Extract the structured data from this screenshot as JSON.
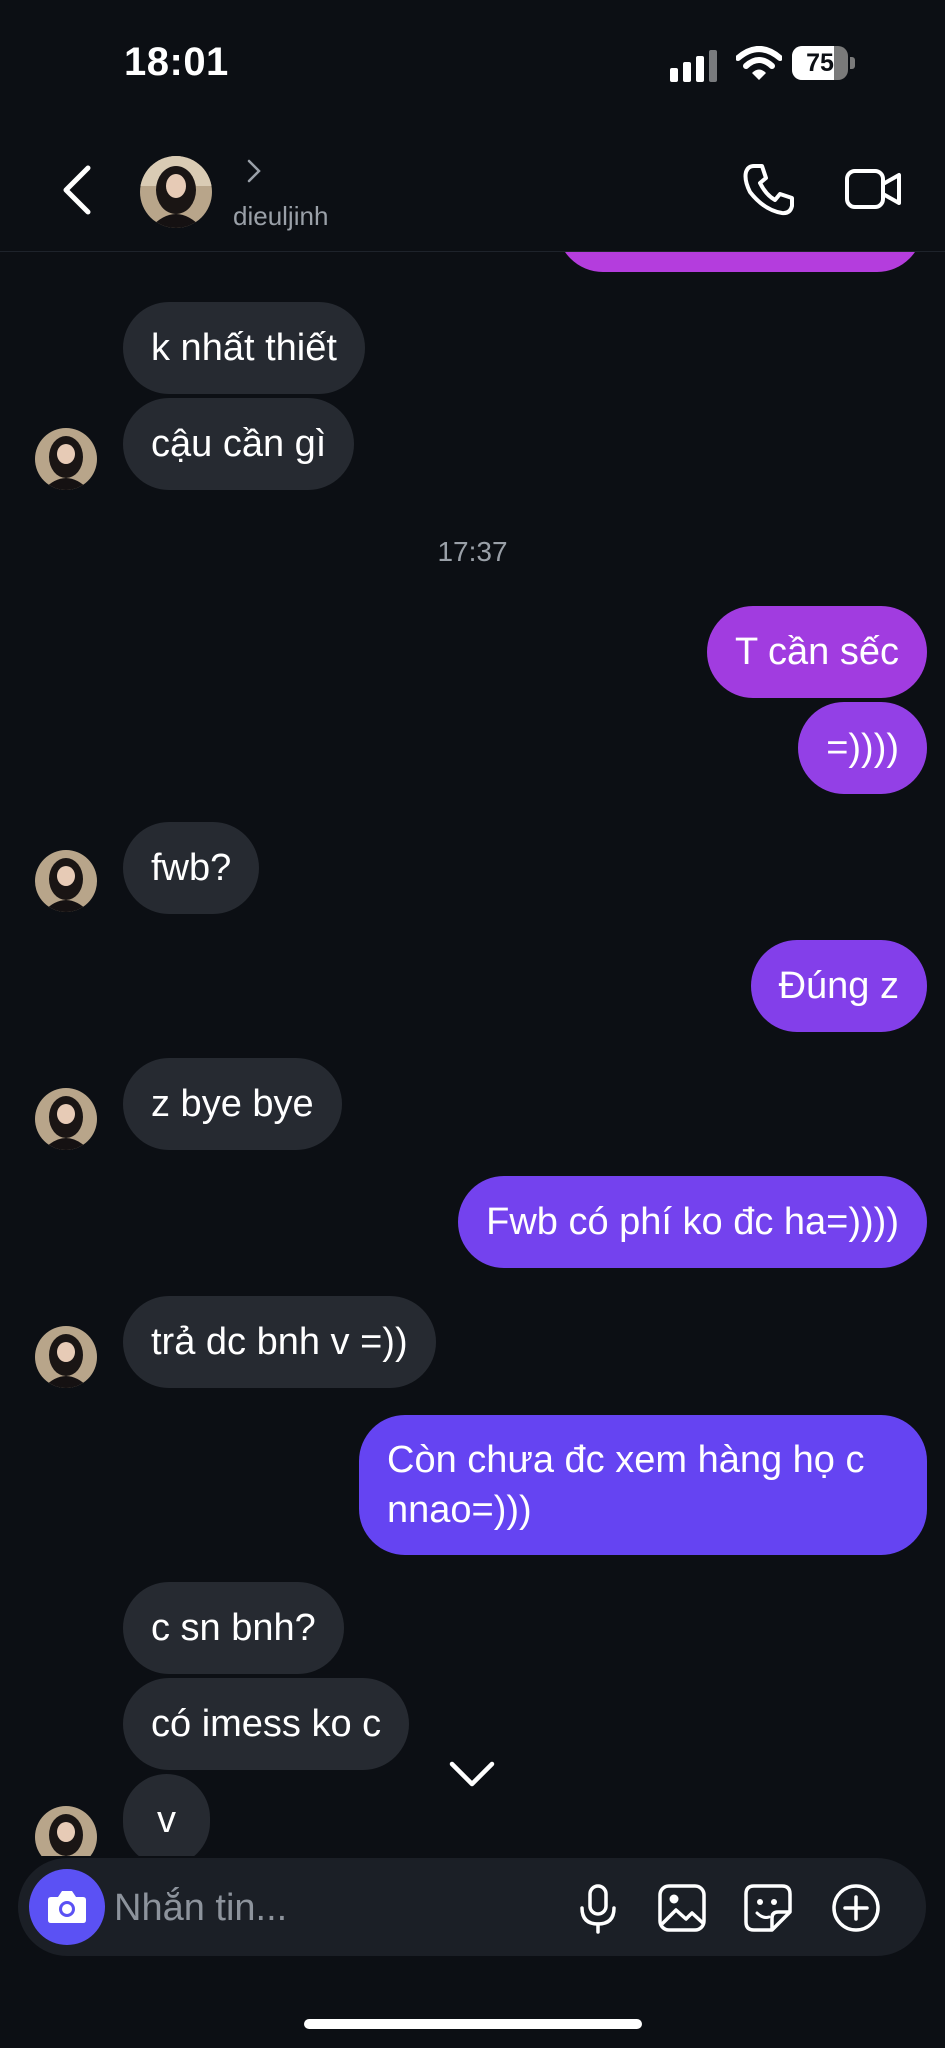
{
  "status_bar": {
    "time": "18:01",
    "battery": "75",
    "battery_level": 0.75
  },
  "header": {
    "username": "dieuljinh"
  },
  "messages": [
    {
      "direction": "in",
      "text": "k nhất thiết"
    },
    {
      "direction": "in",
      "text": "cậu cần gì"
    },
    {
      "type": "timestamp",
      "text": "17:37"
    },
    {
      "direction": "out",
      "text": "T cần sếc"
    },
    {
      "direction": "out",
      "text": "=))))"
    },
    {
      "direction": "in",
      "text": "fwb?"
    },
    {
      "direction": "out",
      "text": "Đúng z"
    },
    {
      "direction": "in",
      "text": "z bye bye"
    },
    {
      "direction": "out",
      "text": "Fwb có phí ko đc ha=))))"
    },
    {
      "direction": "in",
      "text": "trả dc bnh v =))"
    },
    {
      "direction": "out",
      "text": "Còn chưa đc xem hàng họ c nnao=)))"
    },
    {
      "direction": "in",
      "text": "c sn bnh?"
    },
    {
      "direction": "in",
      "text": "có imess ko c"
    },
    {
      "direction": "in",
      "text": "v"
    }
  ],
  "composer": {
    "placeholder": "Nhắn tin..."
  },
  "icons": {
    "back": "chevron-left-icon",
    "phone": "phone-icon",
    "video": "video-camera-icon",
    "camera": "camera-icon",
    "mic": "microphone-icon",
    "gallery": "image-icon",
    "sticker": "sticker-icon",
    "add": "plus-circle-icon",
    "scroll": "chevron-down-icon"
  },
  "colors": {
    "background": "#0c0f14",
    "incoming_bubble": "#262a31",
    "outgoing_gradient_top": "#b83cdc",
    "outgoing_gradient_bottom": "#5f46f4",
    "camera_button": "#5b51f4"
  }
}
